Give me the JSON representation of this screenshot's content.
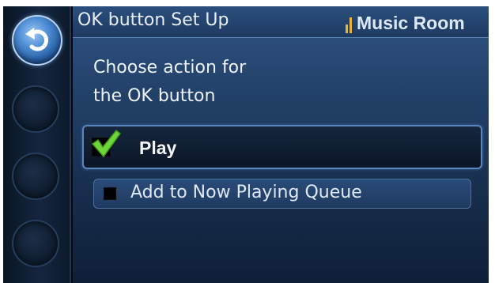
{
  "header": {
    "title": "OK button Set Up",
    "zone": "Music Room",
    "zone_icon": "signal-strength-icon",
    "accent_color": "#e8b53a"
  },
  "prompt": {
    "line1": "Choose action for",
    "line2": "the OK button"
  },
  "options": [
    {
      "label": "Play",
      "checked": true
    },
    {
      "label": "Add to Now Playing Queue",
      "checked": false
    }
  ],
  "rail": {
    "back_icon": "back-arrow-icon",
    "buttons": [
      "rail-button-1",
      "rail-button-2",
      "rail-button-3"
    ]
  },
  "colors": {
    "panel": "#23426a",
    "check": "#6fd63a",
    "text": "#eef3fa"
  }
}
